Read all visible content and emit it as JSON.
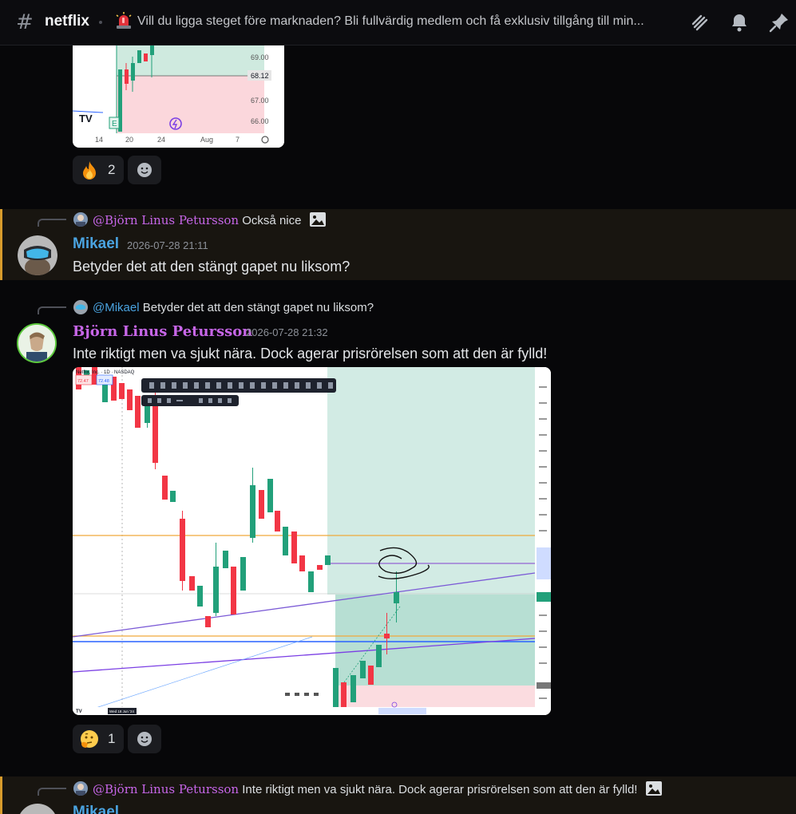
{
  "header": {
    "channel_name": "netflix",
    "topic_emoji": "rotating-light-icon",
    "topic": "Vill du ligga steget före marknaden? Bli fullvärdig medlem och få exklusiv tillgång till min...",
    "icons": [
      "threads-icon",
      "bell-icon",
      "pin-icon"
    ]
  },
  "top_chart": {
    "price_labels": [
      "69.00",
      "68.12",
      "67.00",
      "66.00"
    ],
    "x_labels": [
      "14",
      "20",
      "24",
      "Aug",
      "7"
    ],
    "logo": "TV",
    "earnings_marker": "E"
  },
  "reactions_1": {
    "fire": "2"
  },
  "messages": [
    {
      "reply_to_user": "@Björn Linus Petursson",
      "reply_to_text": "Också nice",
      "username": "Mikael",
      "timestamp": "2026-07-28 21:11",
      "text": "Betyder det att den stängt gapet nu liksom?",
      "name_color": "#4aa3e0"
    },
    {
      "reply_to_user": "@Mikael",
      "reply_to_text": "Betyder det att den stängt gapet nu liksom?",
      "username": "Björn Linus Petursson",
      "timestamp": "2026-07-28 21:32",
      "text": "Inte riktigt men va sjukt nära. Dock agerar prisrörelsen som att den är fylld!",
      "name_color": "#c766e8"
    },
    {
      "reply_to_user": "@Björn Linus Petursson",
      "reply_to_text": "Inte riktigt men va sjukt nära. Dock agerar prisrörelsen som att den är fylld!",
      "username": "Mikael"
    }
  ],
  "chart2": {
    "title": "Netflix, Inc. · 1D · NASDAQ",
    "sell_label": "72.47",
    "buy_label": "72.48",
    "bottom_label": "Wed 18 Jun '24"
  },
  "reactions_2": {
    "thinking": "1"
  },
  "colors": {
    "accent_mention": "#c766e8",
    "highlight_border": "#d79b2c",
    "candle_up": "#22a07a",
    "candle_down": "#f23645"
  }
}
